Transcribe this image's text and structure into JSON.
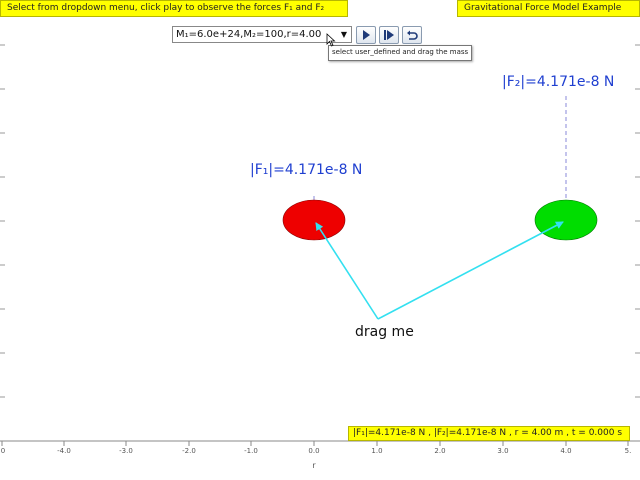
{
  "instructions": "Select from dropdown menu, click play to observe the forces F₁ and F₂",
  "title": "Gravitational Force Model Example",
  "controls": {
    "dropdown_value": "M₁=6.0e+24,M₂=100,r=4.00",
    "tooltip": "select user_defined and drag the mass"
  },
  "labels": {
    "f1": "|F₁|=4.171e-8 N",
    "f2": "|F₂|=4.171e-8 N",
    "drag": "drag me"
  },
  "status": "|F₁|=4.171e-8 N , |F₂|=4.171e-8 N , r = 4.00 m , t = 0.000 s",
  "axis": {
    "label": "r",
    "ticks": [
      "0",
      "-4.0",
      "-3.0",
      "-2.0",
      "-1.0",
      "0.0",
      "1.0",
      "2.0",
      "3.0",
      "4.0",
      "5."
    ]
  },
  "colors": {
    "mass1": "#ee0000",
    "mass2": "#00dd00",
    "vector": "#33e0f0",
    "highlight": "#ffff00"
  },
  "icons": [
    "play-icon",
    "step-icon",
    "reset-icon",
    "dropdown-arrow-icon",
    "cursor-icon"
  ]
}
